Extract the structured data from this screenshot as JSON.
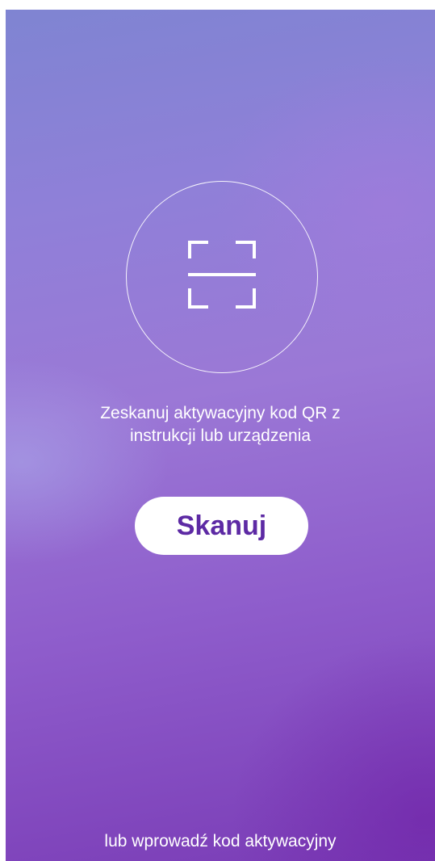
{
  "scanner": {
    "icon": "qr-scan-frame-icon"
  },
  "instruction": {
    "line1": "Zeskanuj aktywacyjny kod QR z",
    "line2": "instrukcji lub urządzenia"
  },
  "scan_button": {
    "label": "Skanuj"
  },
  "manual_entry": {
    "label": "lub wprowadź kod aktywacyjny"
  },
  "colors": {
    "button_text": "#5d2aa4",
    "background_top": "#7f84d2",
    "background_bottom": "#7a3cb6"
  }
}
